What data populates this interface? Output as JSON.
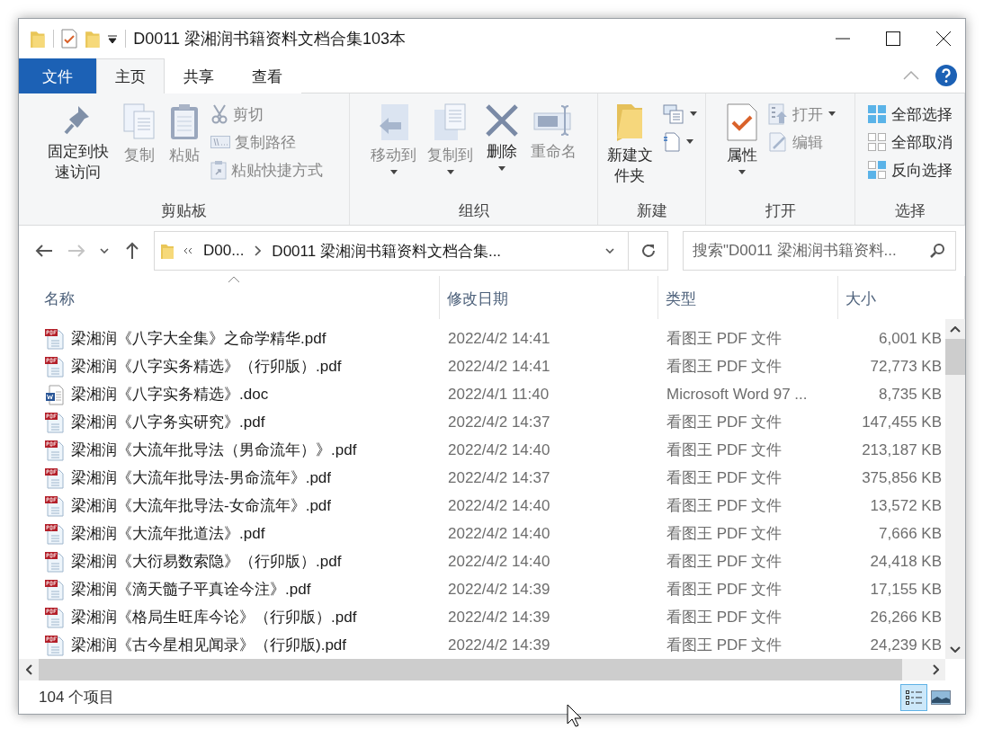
{
  "window": {
    "title": "D0011 梁湘润书籍资料文档合集103本"
  },
  "ribbon_tabs": [
    {
      "label": "文件",
      "kind": "file",
      "selected": false
    },
    {
      "label": "主页",
      "kind": "tab",
      "selected": true
    },
    {
      "label": "共享",
      "kind": "tab",
      "selected": false
    },
    {
      "label": "查看",
      "kind": "tab",
      "selected": false
    }
  ],
  "ribbon_groups": [
    {
      "label": "剪贴板",
      "items": [
        {
          "kind": "large",
          "label": "固定到快速访问",
          "disabled": false,
          "dropdown": false
        },
        {
          "kind": "large",
          "label": "复制",
          "disabled": true,
          "dropdown": false
        },
        {
          "kind": "large",
          "label": "粘贴",
          "disabled": true,
          "dropdown": false
        },
        {
          "kind": "small",
          "label": "剪切",
          "disabled": true,
          "dropdown": false
        },
        {
          "kind": "small",
          "label": "复制路径",
          "disabled": true,
          "dropdown": false
        },
        {
          "kind": "small",
          "label": "粘贴快捷方式",
          "disabled": true,
          "dropdown": false
        }
      ]
    },
    {
      "label": "组织",
      "items": [
        {
          "kind": "large",
          "label": "移动到",
          "disabled": true,
          "dropdown": true
        },
        {
          "kind": "large",
          "label": "复制到",
          "disabled": true,
          "dropdown": true
        },
        {
          "kind": "large",
          "label": "删除",
          "disabled": false,
          "dropdown": true
        },
        {
          "kind": "large",
          "label": "重命名",
          "disabled": true,
          "dropdown": false
        }
      ]
    },
    {
      "label": "新建",
      "items": [
        {
          "kind": "large",
          "label": "新建文件夹",
          "disabled": false,
          "dropdown": false
        },
        {
          "kind": "icon",
          "disabled": false,
          "dropdown": true
        },
        {
          "kind": "icon",
          "disabled": false,
          "dropdown": true
        }
      ]
    },
    {
      "label": "打开",
      "items": [
        {
          "kind": "large",
          "label": "属性",
          "disabled": false,
          "dropdown": true
        },
        {
          "kind": "small",
          "label": "打开",
          "disabled": true,
          "dropdown": true
        },
        {
          "kind": "small",
          "label": "编辑",
          "disabled": true,
          "dropdown": false
        }
      ]
    },
    {
      "label": "选择",
      "items": [
        {
          "kind": "small",
          "label": "全部选择",
          "disabled": false,
          "dropdown": false
        },
        {
          "kind": "small",
          "label": "全部取消",
          "disabled": false,
          "dropdown": false
        },
        {
          "kind": "small",
          "label": "反向选择",
          "disabled": false,
          "dropdown": false
        }
      ]
    }
  ],
  "navigation": [
    {
      "kind": "back",
      "disabled": false
    },
    {
      "kind": "forward",
      "disabled": true
    },
    {
      "kind": "recent",
      "disabled": false
    },
    {
      "kind": "up",
      "disabled": false
    }
  ],
  "address": {
    "path": [
      "D00...",
      "D0011 梁湘润书籍资料文档合集..."
    ]
  },
  "search": {
    "placeholder": "搜索\"D0011 梁湘润书籍资料..."
  },
  "columns": [
    "名称",
    "修改日期",
    "类型",
    "大小"
  ],
  "files": [
    {
      "kind": "pdf",
      "name": "梁湘润《八字大全集》之命学精华.pdf",
      "modified": "2022/4/2 14:41",
      "type": "看图王 PDF 文件",
      "size": "6,001 KB"
    },
    {
      "kind": "pdf",
      "name": "梁湘润《八字实务精选》（行卯版）.pdf",
      "modified": "2022/4/2 14:41",
      "type": "看图王 PDF 文件",
      "size": "72,773 KB"
    },
    {
      "kind": "doc",
      "name": "梁湘润《八字实务精选》.doc",
      "modified": "2022/4/1 11:40",
      "type": "Microsoft Word 97 ...",
      "size": "8,735 KB"
    },
    {
      "kind": "pdf",
      "name": "梁湘润《八字务实研究》.pdf",
      "modified": "2022/4/2 14:37",
      "type": "看图王 PDF 文件",
      "size": "147,455 KB"
    },
    {
      "kind": "pdf",
      "name": "梁湘润《大流年批导法（男命流年）》.pdf",
      "modified": "2022/4/2 14:40",
      "type": "看图王 PDF 文件",
      "size": "213,187 KB"
    },
    {
      "kind": "pdf",
      "name": "梁湘润《大流年批导法-男命流年》.pdf",
      "modified": "2022/4/2 14:37",
      "type": "看图王 PDF 文件",
      "size": "375,856 KB"
    },
    {
      "kind": "pdf",
      "name": "梁湘润《大流年批导法-女命流年》.pdf",
      "modified": "2022/4/2 14:40",
      "type": "看图王 PDF 文件",
      "size": "13,572 KB"
    },
    {
      "kind": "pdf",
      "name": "梁湘润《大流年批道法》.pdf",
      "modified": "2022/4/2 14:40",
      "type": "看图王 PDF 文件",
      "size": "7,666 KB"
    },
    {
      "kind": "pdf",
      "name": "梁湘润《大衍易数索隐》（行卯版）.pdf",
      "modified": "2022/4/2 14:40",
      "type": "看图王 PDF 文件",
      "size": "24,418 KB"
    },
    {
      "kind": "pdf",
      "name": "梁湘润《滴天髓子平真诠今注》.pdf",
      "modified": "2022/4/2 14:39",
      "type": "看图王 PDF 文件",
      "size": "17,155 KB"
    },
    {
      "kind": "pdf",
      "name": "梁湘润《格局生旺库今论》（行卯版）.pdf",
      "modified": "2022/4/2 14:39",
      "type": "看图王 PDF 文件",
      "size": "26,266 KB"
    },
    {
      "kind": "pdf",
      "name": "梁湘润《古今星相见闻录》（行卯版).pdf",
      "modified": "2022/4/2 14:39",
      "type": "看图王 PDF 文件",
      "size": "24,239 KB"
    }
  ],
  "status_bar": {
    "item_count": "104 个项目"
  },
  "view_buttons": [
    {
      "kind": "details",
      "selected": true
    },
    {
      "kind": "thumbnails",
      "selected": false
    }
  ]
}
